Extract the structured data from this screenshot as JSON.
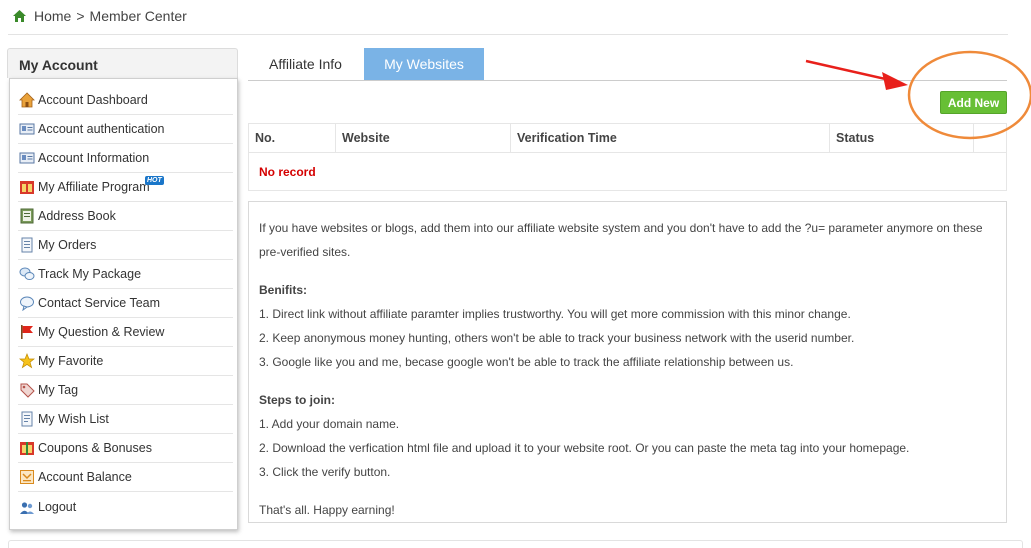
{
  "breadcrumb": {
    "home": "Home",
    "separator": ">",
    "current": "Member Center"
  },
  "sidebar": {
    "title": "My Account",
    "items": [
      {
        "label": "Account Dashboard",
        "icon": "house-icon"
      },
      {
        "label": "Account authentication",
        "icon": "id-card-icon"
      },
      {
        "label": "Account Information",
        "icon": "id-card-icon"
      },
      {
        "label": "My Affiliate Program",
        "icon": "affiliate-icon",
        "badge": "HOT"
      },
      {
        "label": "Address Book",
        "icon": "address-book-icon"
      },
      {
        "label": "My Orders",
        "icon": "document-icon"
      },
      {
        "label": "Track My Package",
        "icon": "chat-bubbles-icon"
      },
      {
        "label": "Contact Service Team",
        "icon": "speech-bubble-icon"
      },
      {
        "label": "My Question & Review",
        "icon": "flag-icon"
      },
      {
        "label": "My Favorite",
        "icon": "star-icon"
      },
      {
        "label": "My Tag",
        "icon": "tag-icon"
      },
      {
        "label": "My Wish List",
        "icon": "list-icon"
      },
      {
        "label": "Coupons & Bonuses",
        "icon": "gift-icon"
      },
      {
        "label": "Account Balance",
        "icon": "balance-icon"
      },
      {
        "label": "Logout",
        "icon": "users-icon"
      }
    ]
  },
  "tabs": [
    {
      "label": "Affiliate Info",
      "active": false
    },
    {
      "label": "My Websites",
      "active": true
    }
  ],
  "add_button": "Add New",
  "table": {
    "columns": [
      "No.",
      "Website",
      "Verification Time",
      "Status"
    ],
    "empty_text": "No record"
  },
  "info": {
    "intro": "If you have websites or blogs, add them into our affiliate website system and you don't have to add the ?u= parameter anymore on these pre-verified sites.",
    "benefits_title": "Benifits:",
    "benefits": [
      "1. Direct link without affiliate paramter implies trustworthy. You will get more commission with this minor change.",
      "2. Keep anonymous money hunting, others won't be able to track your business network with the userid number.",
      "3. Google like you and me, becase google won't be able to track the affiliate relationship between us."
    ],
    "steps_title": "Steps to join:",
    "steps": [
      "1. Add your domain name.",
      "2. Download the verfication html file and upload it to your website root. Or you can paste the meta tag into your homepage.",
      "3. Click the verify button."
    ],
    "outro": "That's all. Happy earning!"
  },
  "colors": {
    "active_tab": "#7ab3e6",
    "add_button": "#67bf35",
    "no_record": "#d40000",
    "annotation_arrow": "#e8201b",
    "annotation_circle": "#ef8a3a"
  }
}
